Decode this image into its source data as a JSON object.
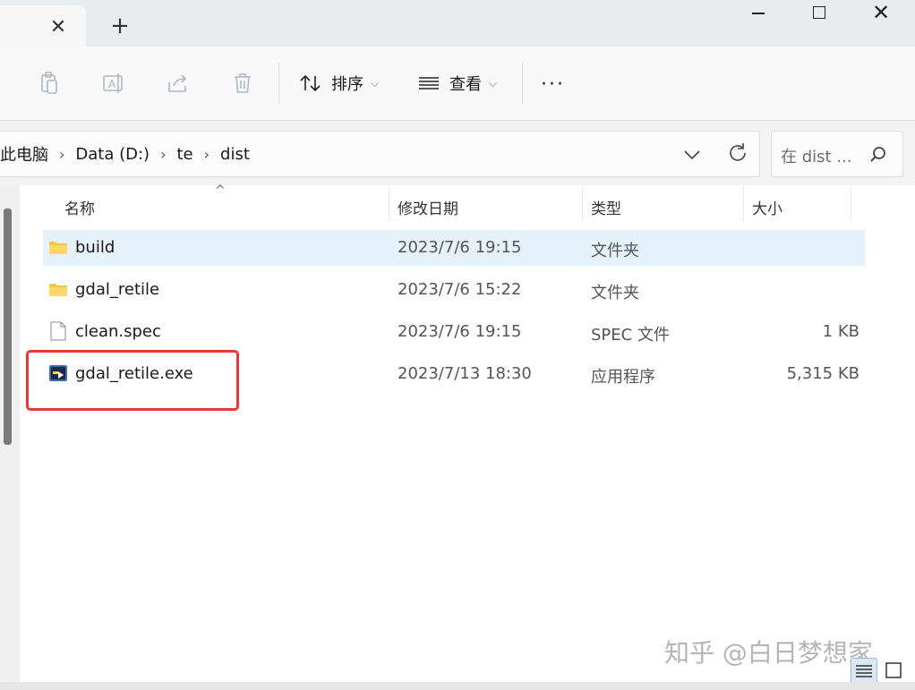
{
  "window": {
    "tab_close_glyph": "✕",
    "new_tab_glyph": "+",
    "controls": [
      "minimize",
      "maximize",
      "close"
    ]
  },
  "toolbar": {
    "icons": [
      "clipboard-icon",
      "rename-icon",
      "share-icon",
      "delete-icon"
    ],
    "sort_label": "排序",
    "view_label": "查看",
    "more_glyph": "···"
  },
  "address": {
    "crumbs": [
      "此电脑",
      "Data (D:)",
      "te",
      "dist"
    ]
  },
  "search": {
    "placeholder": "在 dist ..."
  },
  "columns": {
    "name": "名称",
    "date": "修改日期",
    "type": "类型",
    "size": "大小"
  },
  "files": [
    {
      "name": "build",
      "date": "2023/7/6 19:15",
      "type": "文件夹",
      "size": "",
      "icon": "folder-icon",
      "selected": true
    },
    {
      "name": "gdal_retile",
      "date": "2023/7/6 15:22",
      "type": "文件夹",
      "size": "",
      "icon": "folder-icon",
      "selected": false
    },
    {
      "name": "clean.spec",
      "date": "2023/7/6 19:15",
      "type": "SPEC 文件",
      "size": "1 KB",
      "icon": "file-icon",
      "selected": false
    },
    {
      "name": "gdal_retile.exe",
      "date": "2023/7/13 18:30",
      "type": "应用程序",
      "size": "5,315 KB",
      "icon": "exe-icon",
      "selected": false
    }
  ],
  "watermark": "知乎 @白日梦想家",
  "colors": {
    "selection": "#e5f1fb",
    "highlight": "#e53935",
    "folder": "#f4c542"
  }
}
